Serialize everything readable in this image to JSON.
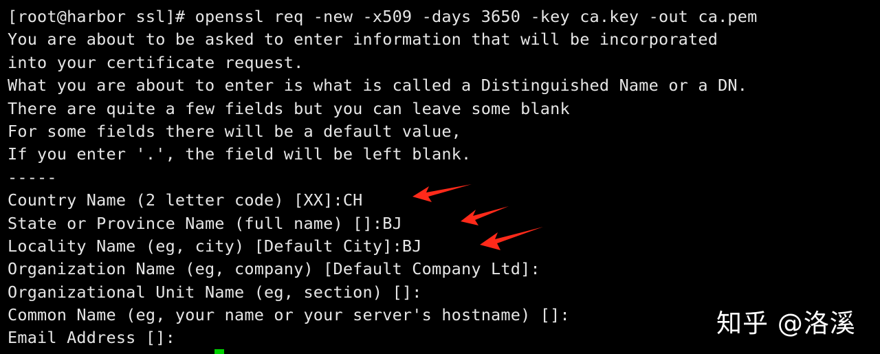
{
  "terminal": {
    "lines": [
      "[root@harbor ssl]# openssl req -new -x509 -days 3650 -key ca.key -out ca.pem",
      "You are about to be asked to enter information that will be incorporated",
      "into your certificate request.",
      "What you are about to enter is what is called a Distinguished Name or a DN.",
      "There are quite a few fields but you can leave some blank",
      "For some fields there will be a default value,",
      "If you enter '.', the field will be left blank.",
      "-----",
      "Country Name (2 letter code) [XX]:CH",
      "State or Province Name (full name) []:BJ",
      "Locality Name (eg, city) [Default City]:BJ",
      "Organization Name (eg, company) [Default Company Ltd]:",
      "Organizational Unit Name (eg, section) []:",
      "Common Name (eg, your name or your server's hostname) []:",
      "Email Address []:"
    ],
    "cursor_color": "#00d000",
    "text_color": "#e6e6e6",
    "background_color": "#000000"
  },
  "annotations": {
    "arrow_color": "#ff2a1a",
    "arrow_icon": "red-arrow-icon"
  },
  "watermark": {
    "text": "知乎 @洛溪"
  }
}
